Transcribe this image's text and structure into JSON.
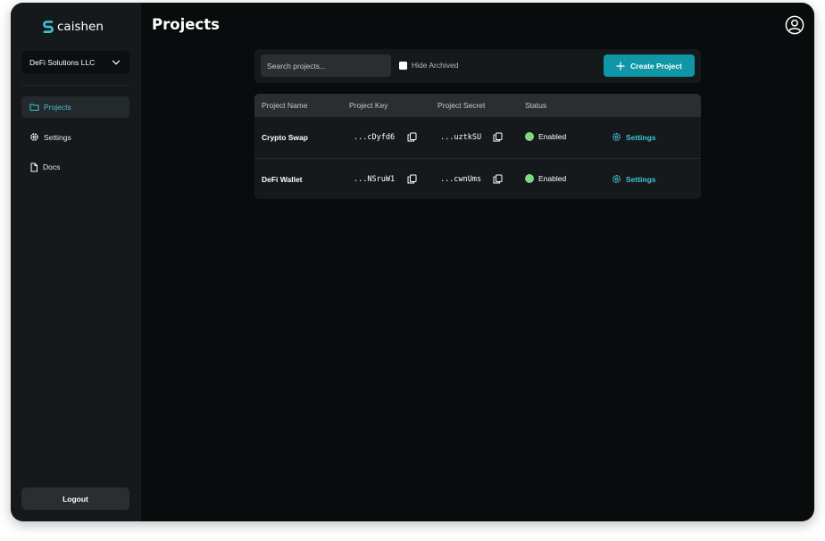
{
  "app": {
    "logo_text": "caishen",
    "page_title": "Projects"
  },
  "sidebar": {
    "org_selector": "DeFi Solutions LLC",
    "items": [
      {
        "label": "Projects",
        "icon": "folder-icon",
        "active": true
      },
      {
        "label": "Settings",
        "icon": "gear-icon",
        "active": false
      },
      {
        "label": "Docs",
        "icon": "document-icon",
        "active": false
      }
    ],
    "logout_label": "Logout"
  },
  "toolbar": {
    "search_placeholder": "Search projects...",
    "hide_archived_label": "Hide Archived",
    "create_label": "Create Project"
  },
  "table": {
    "columns": [
      "Project Name",
      "Project Key",
      "Project Secret",
      "Status"
    ],
    "rows": [
      {
        "name": "Crypto Swap",
        "key": "...cDyfd6",
        "secret": "...uztkSU",
        "status": "Enabled",
        "action": "Settings"
      },
      {
        "name": "DeFi Wallet",
        "key": "...NSruW1",
        "secret": "...cwnUms",
        "status": "Enabled",
        "action": "Settings"
      }
    ]
  },
  "colors": {
    "accent": "#0f97a8",
    "accent_text": "#3ec6d8",
    "status_enabled": "#7fd87f",
    "background": "#090c0d",
    "sidebar": "#16191b"
  }
}
